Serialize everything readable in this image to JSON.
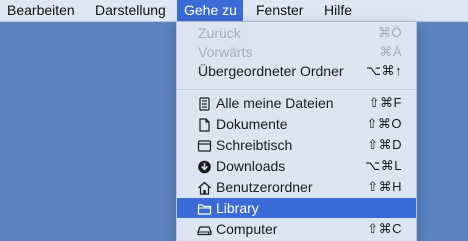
{
  "menubar": {
    "items": [
      {
        "label": "Bearbeiten"
      },
      {
        "label": "Darstellung"
      },
      {
        "label": "Gehe zu"
      },
      {
        "label": "Fenster"
      },
      {
        "label": "Hilfe"
      }
    ],
    "active_index": 2
  },
  "go_menu": {
    "items": [
      {
        "label": "Zurück",
        "shortcut": "⌘Ö",
        "enabled": false,
        "icon": null
      },
      {
        "label": "Vorwärts",
        "shortcut": "⌘Ä",
        "enabled": false,
        "icon": null
      },
      {
        "label": "Übergeordneter Ordner",
        "shortcut": "⌥⌘↑",
        "enabled": true,
        "icon": null
      },
      {
        "label": "Alle meine Dateien",
        "shortcut": "⇧⌘F",
        "enabled": true,
        "icon": "all-files-icon"
      },
      {
        "label": "Dokumente",
        "shortcut": "⇧⌘O",
        "enabled": true,
        "icon": "documents-icon"
      },
      {
        "label": "Schreibtisch",
        "shortcut": "⇧⌘D",
        "enabled": true,
        "icon": "desktop-icon"
      },
      {
        "label": "Downloads",
        "shortcut": "⌥⌘L",
        "enabled": true,
        "icon": "downloads-icon"
      },
      {
        "label": "Benutzerordner",
        "shortcut": "⇧⌘H",
        "enabled": true,
        "icon": "home-icon"
      },
      {
        "label": "Library",
        "shortcut": "",
        "enabled": true,
        "highlighted": true,
        "icon": "folder-icon"
      },
      {
        "label": "Computer",
        "shortcut": "⇧⌘C",
        "enabled": true,
        "icon": "computer-icon"
      }
    ]
  },
  "colors": {
    "desktop": "#5b84c0",
    "menubar": "#dfe6f3",
    "menu": "#dce4f1",
    "highlight": "#3a6bd6",
    "disabled_text": "#a3adbd"
  }
}
